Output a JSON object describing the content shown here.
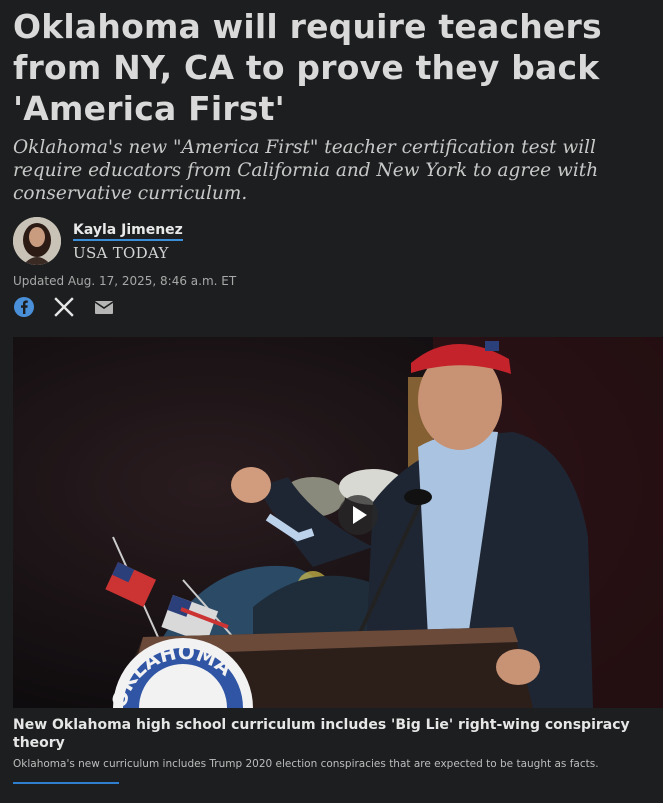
{
  "article": {
    "headline": "Oklahoma will require teachers from NY, CA to prove they back 'America First'",
    "dek": "Oklahoma's new \"America First\" teacher certification test will require educators from California and New York to agree with conservative curriculum.",
    "author": "Kayla Jimenez",
    "outlet": "USA TODAY",
    "updated": "Updated Aug. 17, 2025, 8:46 a.m. ET"
  },
  "share": {
    "icons": [
      "facebook-icon",
      "x-icon",
      "email-icon"
    ]
  },
  "media": {
    "podium_text": "OKLAHOMA",
    "caption_title": "New Oklahoma high school curriculum includes 'Big Lie' right-wing conspiracy theory",
    "caption_desc": "Oklahoma's new curriculum includes Trump 2020 election conspiracies that are expected to be taught as facts."
  },
  "colors": {
    "background": "#1c1e1f",
    "accent": "#3b8fd9",
    "facebook": "#4a90d9"
  }
}
